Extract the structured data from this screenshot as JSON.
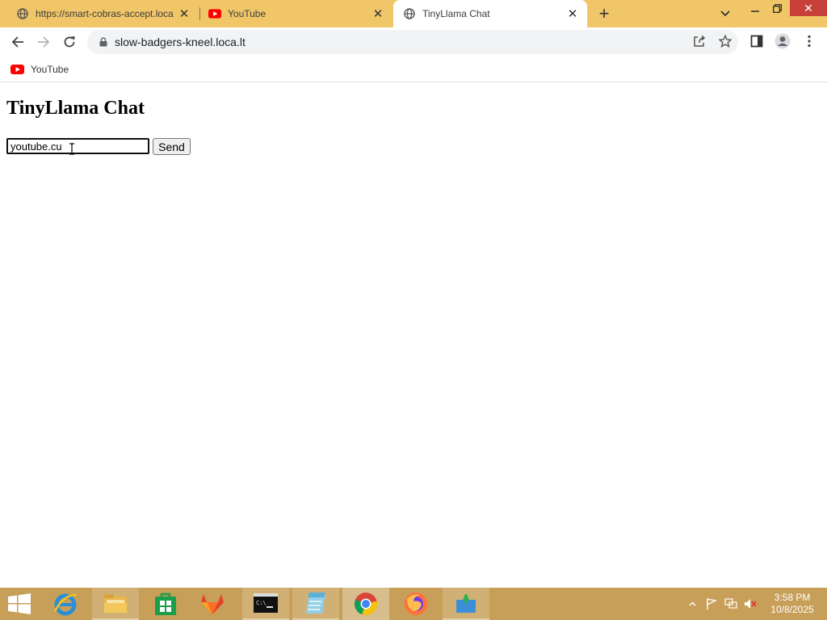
{
  "browser": {
    "tabs": [
      {
        "title": "https://smart-cobras-accept.loca",
        "icon": "globe-icon",
        "active": false
      },
      {
        "title": "YouTube",
        "icon": "youtube-icon",
        "active": false
      },
      {
        "title": "TinyLlama Chat",
        "icon": "globe-icon",
        "active": true
      }
    ],
    "address_bar": {
      "url": "slow-badgers-kneel.loca.lt"
    },
    "bookmarks": [
      {
        "label": "YouTube",
        "icon": "youtube-icon"
      }
    ]
  },
  "page": {
    "heading": "TinyLlama Chat",
    "input_value": "youtube.cu",
    "send_label": "Send"
  },
  "taskbar": {
    "time": "3:58 PM",
    "date": "10/8/2025"
  },
  "colors": {
    "tabstrip": "#f0c668",
    "taskbar": "#c79f58",
    "youtube_red": "#ff0000",
    "close_red": "#c8403a"
  }
}
